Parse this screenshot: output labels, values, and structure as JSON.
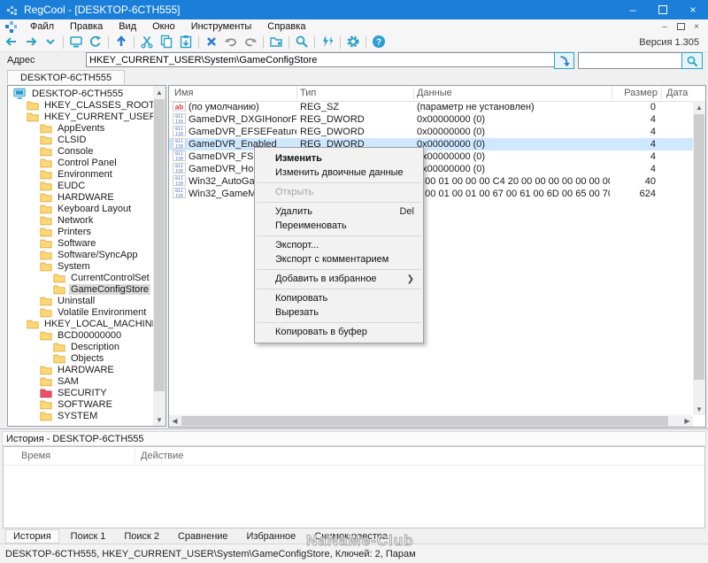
{
  "colors": {
    "titlebar": "#1b7fd9",
    "icon_teal": "#2aa2c6",
    "icon_blue": "#2b7cd3",
    "icon_gray": "#8f8f8f",
    "selection_row": "#cfe8ff",
    "selection_tree": "#d9d9d9",
    "folder_yellow": "#fdd874",
    "folder_red": "#ef5067"
  },
  "window": {
    "title": "RegCool - [DESKTOP-6CTH555]",
    "buttons": [
      "minimize",
      "maximize",
      "close"
    ]
  },
  "menu": {
    "items": [
      "Файл",
      "Правка",
      "Вид",
      "Окно",
      "Инструменты",
      "Справка"
    ],
    "mdi_buttons": [
      "mdi-minimize",
      "mdi-restore",
      "mdi-close"
    ]
  },
  "toolbar": {
    "version": "Версия 1.305",
    "groups": [
      [
        "back",
        "forward",
        "chevron-down"
      ],
      [
        "computer",
        "refresh"
      ],
      [
        "arrow-up"
      ],
      [
        "cut",
        "copy",
        "paste"
      ],
      [
        "delete",
        "undo",
        "redo"
      ],
      [
        "new-key"
      ],
      [
        "search"
      ],
      [
        "lightning"
      ],
      [
        "gear"
      ],
      [
        "help"
      ]
    ]
  },
  "address": {
    "label": "Адрес",
    "value": "HKEY_CURRENT_USER\\System\\GameConfigStore",
    "filter_value": ""
  },
  "doc_tab": "DESKTOP-6CTH555",
  "tree": {
    "items": [
      {
        "label": "DESKTOP-6CTH555",
        "level": 0,
        "icon": "computer"
      },
      {
        "label": "HKEY_CLASSES_ROOT",
        "level": 1,
        "icon": "folder"
      },
      {
        "label": "HKEY_CURRENT_USER",
        "level": 1,
        "icon": "folder"
      },
      {
        "label": "AppEvents",
        "level": 2,
        "icon": "folder"
      },
      {
        "label": "CLSID",
        "level": 2,
        "icon": "folder"
      },
      {
        "label": "Console",
        "level": 2,
        "icon": "folder"
      },
      {
        "label": "Control Panel",
        "level": 2,
        "icon": "folder"
      },
      {
        "label": "Environment",
        "level": 2,
        "icon": "folder"
      },
      {
        "label": "EUDC",
        "level": 2,
        "icon": "folder"
      },
      {
        "label": "HARDWARE",
        "level": 2,
        "icon": "folder"
      },
      {
        "label": "Keyboard Layout",
        "level": 2,
        "icon": "folder"
      },
      {
        "label": "Network",
        "level": 2,
        "icon": "folder"
      },
      {
        "label": "Printers",
        "level": 2,
        "icon": "folder"
      },
      {
        "label": "Software",
        "level": 2,
        "icon": "folder"
      },
      {
        "label": "Software/SyncApp",
        "level": 2,
        "icon": "folder"
      },
      {
        "label": "System",
        "level": 2,
        "icon": "folder"
      },
      {
        "label": "CurrentControlSet",
        "level": 3,
        "icon": "folder"
      },
      {
        "label": "GameConfigStore",
        "level": 3,
        "icon": "folder",
        "selected": true
      },
      {
        "label": "Uninstall",
        "level": 2,
        "icon": "folder"
      },
      {
        "label": "Volatile Environment",
        "level": 2,
        "icon": "folder"
      },
      {
        "label": "HKEY_LOCAL_MACHINE",
        "level": 1,
        "icon": "folder"
      },
      {
        "label": "BCD00000000",
        "level": 2,
        "icon": "folder"
      },
      {
        "label": "Description",
        "level": 3,
        "icon": "folder"
      },
      {
        "label": "Objects",
        "level": 3,
        "icon": "folder"
      },
      {
        "label": "HARDWARE",
        "level": 2,
        "icon": "folder"
      },
      {
        "label": "SAM",
        "level": 2,
        "icon": "folder"
      },
      {
        "label": "SECURITY",
        "level": 2,
        "icon": "folder-red"
      },
      {
        "label": "SOFTWARE",
        "level": 2,
        "icon": "folder"
      },
      {
        "label": "SYSTEM",
        "level": 2,
        "icon": "folder"
      }
    ]
  },
  "list": {
    "columns": [
      "Имя",
      "Тип",
      "Данные",
      "Размер",
      "Дата"
    ],
    "rows": [
      {
        "icon": "string",
        "name": "(по умолчанию)",
        "type": "REG_SZ",
        "data": "(параметр не установлен)",
        "size": "0",
        "date": ""
      },
      {
        "icon": "dword",
        "name": "GameDVR_DXGIHonorFSEWind...",
        "type": "REG_DWORD",
        "data": "0x00000000 (0)",
        "size": "4",
        "date": ""
      },
      {
        "icon": "dword",
        "name": "GameDVR_EFSEFeatureFlags",
        "type": "REG_DWORD",
        "data": "0x00000000 (0)",
        "size": "4",
        "date": ""
      },
      {
        "icon": "dword",
        "name": "GameDVR_Enabled",
        "type": "REG_DWORD",
        "data": "0x00000000 (0)",
        "size": "4",
        "date": "",
        "selected": true
      },
      {
        "icon": "dword",
        "name": "GameDVR_FSEBeha",
        "type": "",
        "data": "0x00000000 (0)",
        "size": "4",
        "date": ""
      },
      {
        "icon": "dword",
        "name": "GameDVR_HonorUs",
        "type": "",
        "data": "0x00000000 (0)",
        "size": "4",
        "date": ""
      },
      {
        "icon": "dword",
        "name": "Win32_AutoGameM",
        "type": "",
        "data": "2 00 01 00 00 00 C4 20 00 00 00 00 00 00 00 00 00 00 00 ...",
        "size": "40",
        "date": ""
      },
      {
        "icon": "dword",
        "name": "Win32_GameModel",
        "type": "",
        "data": "1 00 01 00 01 00 67 00 61 00 6D 00 65 00 70 00 61 00 ...",
        "size": "624",
        "date": ""
      }
    ]
  },
  "context_menu": {
    "items": [
      {
        "label": "Изменить",
        "bold": true
      },
      {
        "label": "Изменить двоичные данные"
      },
      {
        "sep": true
      },
      {
        "label": "Открыть",
        "disabled": true
      },
      {
        "sep": true
      },
      {
        "label": "Удалить",
        "shortcut": "Del"
      },
      {
        "label": "Переименовать"
      },
      {
        "sep": true
      },
      {
        "label": "Экспорт..."
      },
      {
        "label": "Экспорт с комментарием"
      },
      {
        "sep": true
      },
      {
        "label": "Добавить в избранное",
        "submenu": true
      },
      {
        "sep": true
      },
      {
        "label": "Копировать"
      },
      {
        "label": "Вырезать"
      },
      {
        "sep": true
      },
      {
        "label": "Копировать в буфер"
      }
    ]
  },
  "history": {
    "title": "История - DESKTOP-6CTH555",
    "columns": [
      "Время",
      "Действие"
    ]
  },
  "bottom_tabs": {
    "active": 0,
    "items": [
      "История",
      "Поиск 1",
      "Поиск 2",
      "Сравнение",
      "Избранное",
      "Снимок реестра"
    ]
  },
  "status": {
    "text": "DESKTOP-6CTH555, HKEY_CURRENT_USER\\System\\GameConfigStore, Ключей: 2, Парам",
    "watermark": "NaNaMe-Club"
  }
}
